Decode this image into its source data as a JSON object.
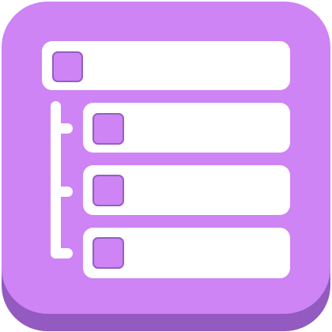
{
  "app_icon": {
    "icon_name": "hierarchy-list-icon",
    "colors": {
      "face": "#CE84F4",
      "base": "#935ABF",
      "glyph": "#FFFFFF",
      "checkbox_fill": "#CE84F4",
      "checkbox_stroke": "#955EC2"
    },
    "rows": [
      {
        "level": 0,
        "name": "parent-row"
      },
      {
        "level": 1,
        "name": "child-row-1"
      },
      {
        "level": 1,
        "name": "child-row-2"
      },
      {
        "level": 1,
        "name": "child-row-3"
      }
    ]
  }
}
